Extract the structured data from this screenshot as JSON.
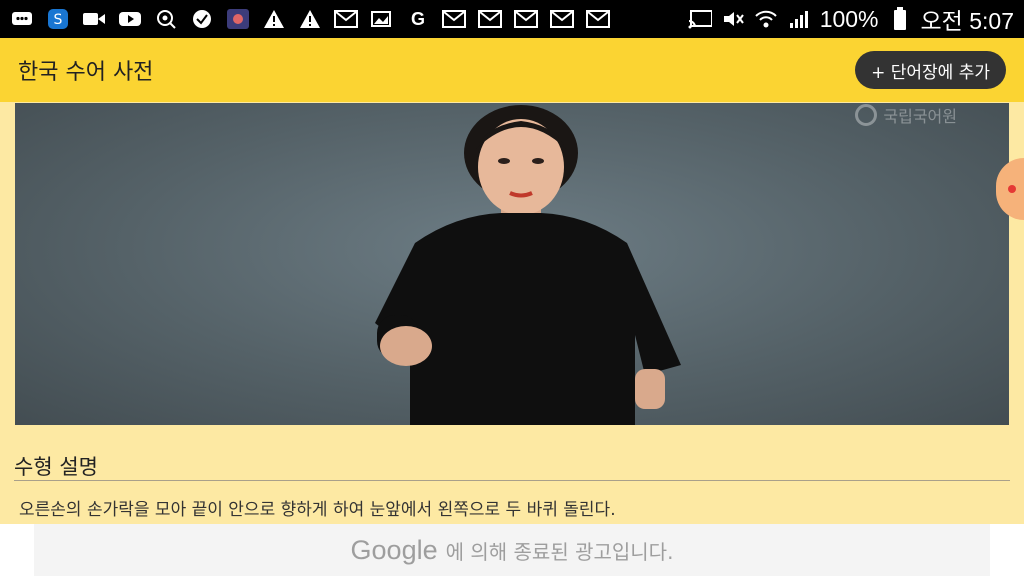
{
  "statusbar": {
    "icons": [
      "message-icon",
      "s-app-icon",
      "video-icon",
      "youtube-icon",
      "search-location-icon",
      "check-icon",
      "photo-icon",
      "warning-icon",
      "warning-icon",
      "mail-icon",
      "gallery-icon",
      "google-icon",
      "mail-icon",
      "mail-icon",
      "mail-icon",
      "mail-icon",
      "mail-icon"
    ],
    "battery": "100%",
    "time": "오전 5:07"
  },
  "app": {
    "title": "한국 수어 사전",
    "add_button": "+ 단어장에 추가"
  },
  "video": {
    "watermark": "국립국어원"
  },
  "section": {
    "title": "수형 설명",
    "description": "오른손의 손가락을 모아 끝이 안으로 향하게 하여 눈앞에서 왼쪽으로 두 바퀴 돌린다."
  },
  "ad": {
    "brand": "Google",
    "message": "에 의해 종료된 광고입니다."
  },
  "colors": {
    "header": "#fbd432",
    "background": "#fde9a3",
    "button": "#333333"
  }
}
